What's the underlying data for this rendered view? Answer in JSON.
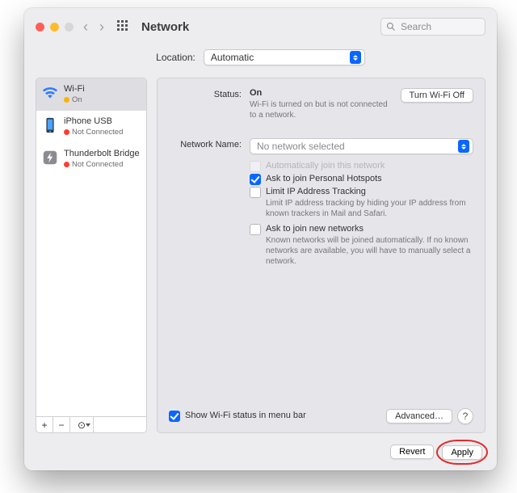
{
  "titlebar": {
    "title": "Network",
    "search_placeholder": "Search"
  },
  "location": {
    "label": "Location:",
    "value": "Automatic"
  },
  "sidebar": {
    "items": [
      {
        "name": "Wi-Fi",
        "status": "On",
        "dot": "s-yellow"
      },
      {
        "name": "iPhone USB",
        "status": "Not Connected",
        "dot": "s-red"
      },
      {
        "name": "Thunderbolt Bridge",
        "status": "Not Connected",
        "dot": "s-red"
      }
    ],
    "add": "+",
    "remove": "−",
    "gear": "⊙"
  },
  "detail": {
    "status_label": "Status:",
    "status_value": "On",
    "turn_off": "Turn Wi-Fi Off",
    "status_sub": "Wi-Fi is turned on but is not connected to a network.",
    "netname_label": "Network Name:",
    "netname_value": "No network selected",
    "auto_join": "Automatically join this network",
    "hotspot": "Ask to join Personal Hotspots",
    "limit_ip": "Limit IP Address Tracking",
    "limit_ip_sub": "Limit IP address tracking by hiding your IP address from known trackers in Mail and Safari.",
    "ask_new": "Ask to join new networks",
    "ask_new_sub": "Known networks will be joined automatically. If no known networks are available, you will have to manually select a network.",
    "menubar": "Show Wi-Fi status in menu bar",
    "advanced": "Advanced…",
    "help": "?"
  },
  "footer": {
    "revert": "Revert",
    "apply": "Apply"
  }
}
